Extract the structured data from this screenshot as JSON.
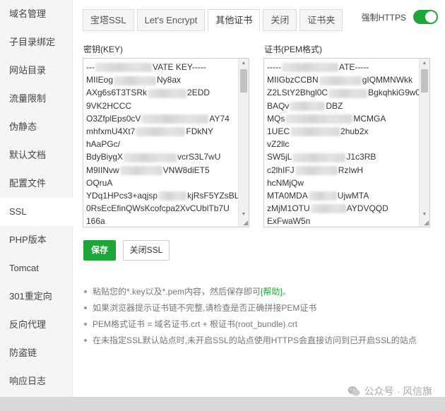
{
  "sidebar": {
    "items": [
      {
        "label": "域名管理"
      },
      {
        "label": "子目录绑定"
      },
      {
        "label": "网站目录"
      },
      {
        "label": "流量限制"
      },
      {
        "label": "伪静态"
      },
      {
        "label": "默认文档"
      },
      {
        "label": "配置文件"
      },
      {
        "label": "SSL",
        "active": true
      },
      {
        "label": "PHP版本"
      },
      {
        "label": "Tomcat"
      },
      {
        "label": "301重定向"
      },
      {
        "label": "反向代理"
      },
      {
        "label": "防盗链"
      },
      {
        "label": "响应日志"
      }
    ]
  },
  "tabs": [
    {
      "label": "宝塔SSL"
    },
    {
      "label": "Let's Encrypt"
    },
    {
      "label": "其他证书",
      "active": true
    },
    {
      "label": "关闭"
    },
    {
      "label": "证书夹"
    }
  ],
  "force_https": {
    "label": "强制HTTPS",
    "enabled": true
  },
  "key_field": {
    "label": "密钥(KEY)",
    "lines": [
      "---",
      "VATE KEY-----",
      "MIIEog",
      "Ny8ax",
      "AXg6s6T3TSRk",
      "2EDD",
      "9VK2HCCC",
      "",
      "O3ZfplEps0cV",
      "AY74",
      "mhfxmU4Xt7",
      "FDkNY",
      "hAaPGc/",
      "",
      "BdyBiygX",
      "vcrS3L7wU",
      "M9IINvw",
      "VNW8diET5",
      "OQruA",
      "",
      "YDq1HPcs3+aqjsp",
      "kjRsF5YZsBL",
      "0RsEcEfinQWsKcofcpa2XvCUblTb7U",
      "",
      "166a",
      ""
    ]
  },
  "cert_field": {
    "label": "证书(PEM格式)",
    "lines": [
      "-----",
      "ATE-----",
      "MIIGbzCCBN",
      "gIQMMNWkk",
      "Z2LStY2Bhgl0C",
      "BgkqhkiG9w0",
      "BAQv",
      "DBZ",
      "MQs",
      "MCMGA",
      "1UEC",
      "2hub2x",
      "vZ2llc",
      "",
      "SW5jL",
      "J1c3RB",
      "c2lhIFJ",
      "RzIwH",
      "hcNMjQw",
      "",
      "MTA0MDA",
      "UjwMTA",
      "zMjM1OTU",
      "AYDVQQD",
      "ExFwaW5n",
      ""
    ]
  },
  "buttons": {
    "save": "保存",
    "close_ssl": "关闭SSL"
  },
  "tips": {
    "t1_prefix": "粘贴您的*.key以及*.pem内容，然后保存即可",
    "t1_link": "[帮助]",
    "t1_suffix": "。",
    "t2": "如果浏览器提示证书链不完整,请检查是否正确拼接PEM证书",
    "t3": "PEM格式证书 = 域名证书.crt + 根证书(root_bundle).crt",
    "t4": "在未指定SSL默认站点时,未开启SSL的站点使用HTTPS会直接访问到已开启SSL的站点"
  },
  "watermark": "公众号 · 风信旗",
  "colors": {
    "accent": "#20a53a",
    "link": "#20a53a"
  }
}
